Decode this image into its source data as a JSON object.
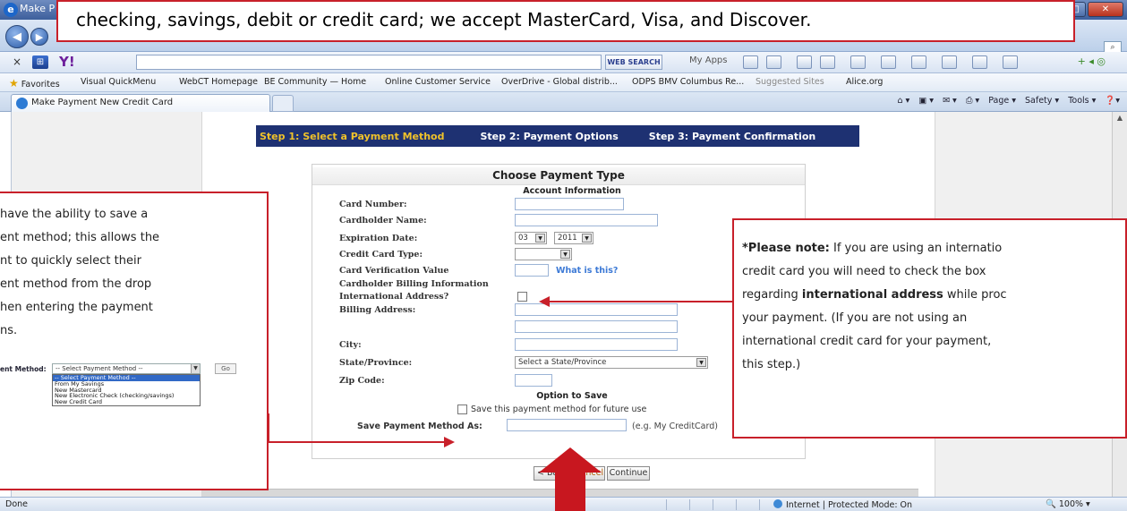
{
  "browser": {
    "window_title": "Make P",
    "search_placeholder": "",
    "web_search_label": "WEB SEARCH",
    "my_apps_label": "My Apps",
    "favorites_label": "Favorites",
    "favorites": [
      "Visual QuickMenu",
      "WebCT Homepage",
      "BE Community — Home",
      "Online Customer Service",
      "OverDrive - Global distrib...",
      "ODPS BMV Columbus Re...",
      "Suggested Sites",
      "Alice.org"
    ],
    "tab_title": "Make Payment New Credit Card",
    "command_bar": [
      "Page",
      "Safety",
      "Tools"
    ],
    "status_text": "Done",
    "status_zone": "Internet | Protected Mode: On",
    "zoom": "100%"
  },
  "steps": {
    "step1": "Step 1: Select a Payment Method",
    "step2": "Step 2: Payment Options",
    "step3": "Step 3: Payment Confirmation"
  },
  "form": {
    "title": "Choose Payment Type",
    "account_info_heading": "Account Information",
    "labels": {
      "card_number": "Card Number:",
      "cardholder_name": "Cardholder Name:",
      "expiration_date": "Expiration Date:",
      "credit_card_type": "Credit Card Type:",
      "card_verification": "Card Verification Value",
      "billing_info": "Cardholder Billing Information",
      "international": "International Address?",
      "billing_address": "Billing Address:",
      "city": "City:",
      "state": "State/Province:",
      "zip": "Zip Code:"
    },
    "expiration_month": "03",
    "expiration_year": "2011",
    "credit_card_type_value": "",
    "what_is_this": "What is this?",
    "state_value": "Select a State/Province",
    "option_to_save_heading": "Option to Save",
    "save_checkbox_label": "Save this payment method for future use",
    "save_as_label": "Save Payment Method As:",
    "save_as_hint": "(e.g. My CreditCard)",
    "buttons": {
      "back": "< Back",
      "cancel": "Cancel",
      "continue": "Continue"
    }
  },
  "callouts": {
    "top_banner": "checking, savings, debit or credit card; we accept MasterCard, Visa, and Discover.",
    "left_lines": [
      "have the ability to save a",
      "ent method; this allows the",
      "nt to quickly select their",
      "ent method from the drop",
      "hen entering the payment",
      "ns."
    ],
    "mini_widget": {
      "label": "ent Method:",
      "selected": "-- Select Payment Method --",
      "go": "Go",
      "options": [
        "-- Select Payment Method --",
        "From My Savings",
        "New Mastercard",
        "New Electronic Check (checking/savings)",
        "New Credit Card"
      ]
    },
    "right": {
      "please_note": "*Please note:",
      "line1_rest": " If you are using an internatio",
      "line2": "credit card you will need to check the box",
      "line3_pre": "regarding ",
      "line3_bold": "international address",
      "line3_post": " while proc",
      "line4": "your payment.    (If you are not using an",
      "line5": "international credit card for your payment,",
      "line6": "this step.)"
    }
  },
  "colors": {
    "callout_border": "#c8202a",
    "steps_bar": "#1e3172",
    "active_step": "#f0c22a",
    "link": "#3d7ad6"
  }
}
